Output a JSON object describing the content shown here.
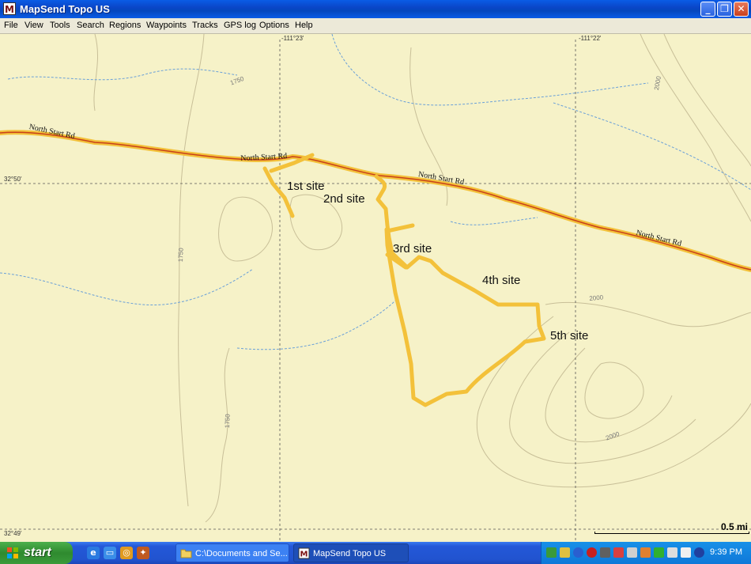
{
  "window": {
    "title": "MapSend Topo US",
    "app_icon_glyph": "M",
    "controls": {
      "minimize": "_",
      "maximize": "❐",
      "close": "✕"
    }
  },
  "menu": [
    "File",
    "View",
    "Tools",
    "Search",
    "Regions",
    "Waypoints",
    "Tracks",
    "GPS log",
    "Options",
    "Help"
  ],
  "map": {
    "longitude_labels": [
      "-111°23'",
      "-111°22'"
    ],
    "latitude_labels": [
      "32°50'",
      "32°49'"
    ],
    "road_labels": [
      "North Start Rd",
      "North Start Rd",
      "North Start Rd",
      "North Start Rd"
    ],
    "contour_labels": [
      "1750",
      "1750",
      "1750",
      "2000",
      "2000",
      "2000"
    ],
    "site_labels": [
      "1st site",
      "2nd site",
      "3rd site",
      "4th site",
      "5th site"
    ],
    "scale": "0.5 mi",
    "colors": {
      "background": "#f6f2c8",
      "road": "#c8401a",
      "track": "#f3c13a",
      "water": "#6aa0d8",
      "contour": "#b8ad88"
    }
  },
  "taskbar": {
    "start_label": "start",
    "quick_launch_icons": [
      "ie-icon",
      "desktop-icon",
      "media-icon",
      "app-icon"
    ],
    "tasks": [
      {
        "label": "C:\\Documents and Se...",
        "icon": "folder-icon"
      },
      {
        "label": "MapSend Topo US",
        "icon": "mapsend-icon"
      }
    ],
    "clock": "9:39 PM"
  }
}
